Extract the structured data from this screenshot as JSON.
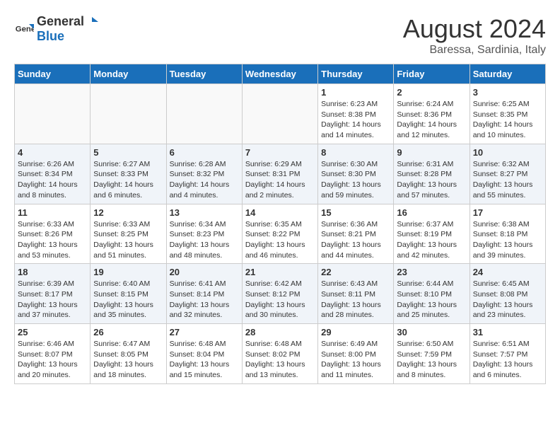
{
  "logo": {
    "text_general": "General",
    "text_blue": "Blue"
  },
  "title": "August 2024",
  "location": "Baressa, Sardinia, Italy",
  "days_header": [
    "Sunday",
    "Monday",
    "Tuesday",
    "Wednesday",
    "Thursday",
    "Friday",
    "Saturday"
  ],
  "weeks": [
    [
      {
        "day": "",
        "info": ""
      },
      {
        "day": "",
        "info": ""
      },
      {
        "day": "",
        "info": ""
      },
      {
        "day": "",
        "info": ""
      },
      {
        "day": "1",
        "info": "Sunrise: 6:23 AM\nSunset: 8:38 PM\nDaylight: 14 hours and 14 minutes."
      },
      {
        "day": "2",
        "info": "Sunrise: 6:24 AM\nSunset: 8:36 PM\nDaylight: 14 hours and 12 minutes."
      },
      {
        "day": "3",
        "info": "Sunrise: 6:25 AM\nSunset: 8:35 PM\nDaylight: 14 hours and 10 minutes."
      }
    ],
    [
      {
        "day": "4",
        "info": "Sunrise: 6:26 AM\nSunset: 8:34 PM\nDaylight: 14 hours and 8 minutes."
      },
      {
        "day": "5",
        "info": "Sunrise: 6:27 AM\nSunset: 8:33 PM\nDaylight: 14 hours and 6 minutes."
      },
      {
        "day": "6",
        "info": "Sunrise: 6:28 AM\nSunset: 8:32 PM\nDaylight: 14 hours and 4 minutes."
      },
      {
        "day": "7",
        "info": "Sunrise: 6:29 AM\nSunset: 8:31 PM\nDaylight: 14 hours and 2 minutes."
      },
      {
        "day": "8",
        "info": "Sunrise: 6:30 AM\nSunset: 8:30 PM\nDaylight: 13 hours and 59 minutes."
      },
      {
        "day": "9",
        "info": "Sunrise: 6:31 AM\nSunset: 8:28 PM\nDaylight: 13 hours and 57 minutes."
      },
      {
        "day": "10",
        "info": "Sunrise: 6:32 AM\nSunset: 8:27 PM\nDaylight: 13 hours and 55 minutes."
      }
    ],
    [
      {
        "day": "11",
        "info": "Sunrise: 6:33 AM\nSunset: 8:26 PM\nDaylight: 13 hours and 53 minutes."
      },
      {
        "day": "12",
        "info": "Sunrise: 6:33 AM\nSunset: 8:25 PM\nDaylight: 13 hours and 51 minutes."
      },
      {
        "day": "13",
        "info": "Sunrise: 6:34 AM\nSunset: 8:23 PM\nDaylight: 13 hours and 48 minutes."
      },
      {
        "day": "14",
        "info": "Sunrise: 6:35 AM\nSunset: 8:22 PM\nDaylight: 13 hours and 46 minutes."
      },
      {
        "day": "15",
        "info": "Sunrise: 6:36 AM\nSunset: 8:21 PM\nDaylight: 13 hours and 44 minutes."
      },
      {
        "day": "16",
        "info": "Sunrise: 6:37 AM\nSunset: 8:19 PM\nDaylight: 13 hours and 42 minutes."
      },
      {
        "day": "17",
        "info": "Sunrise: 6:38 AM\nSunset: 8:18 PM\nDaylight: 13 hours and 39 minutes."
      }
    ],
    [
      {
        "day": "18",
        "info": "Sunrise: 6:39 AM\nSunset: 8:17 PM\nDaylight: 13 hours and 37 minutes."
      },
      {
        "day": "19",
        "info": "Sunrise: 6:40 AM\nSunset: 8:15 PM\nDaylight: 13 hours and 35 minutes."
      },
      {
        "day": "20",
        "info": "Sunrise: 6:41 AM\nSunset: 8:14 PM\nDaylight: 13 hours and 32 minutes."
      },
      {
        "day": "21",
        "info": "Sunrise: 6:42 AM\nSunset: 8:12 PM\nDaylight: 13 hours and 30 minutes."
      },
      {
        "day": "22",
        "info": "Sunrise: 6:43 AM\nSunset: 8:11 PM\nDaylight: 13 hours and 28 minutes."
      },
      {
        "day": "23",
        "info": "Sunrise: 6:44 AM\nSunset: 8:10 PM\nDaylight: 13 hours and 25 minutes."
      },
      {
        "day": "24",
        "info": "Sunrise: 6:45 AM\nSunset: 8:08 PM\nDaylight: 13 hours and 23 minutes."
      }
    ],
    [
      {
        "day": "25",
        "info": "Sunrise: 6:46 AM\nSunset: 8:07 PM\nDaylight: 13 hours and 20 minutes."
      },
      {
        "day": "26",
        "info": "Sunrise: 6:47 AM\nSunset: 8:05 PM\nDaylight: 13 hours and 18 minutes."
      },
      {
        "day": "27",
        "info": "Sunrise: 6:48 AM\nSunset: 8:04 PM\nDaylight: 13 hours and 15 minutes."
      },
      {
        "day": "28",
        "info": "Sunrise: 6:48 AM\nSunset: 8:02 PM\nDaylight: 13 hours and 13 minutes."
      },
      {
        "day": "29",
        "info": "Sunrise: 6:49 AM\nSunset: 8:00 PM\nDaylight: 13 hours and 11 minutes."
      },
      {
        "day": "30",
        "info": "Sunrise: 6:50 AM\nSunset: 7:59 PM\nDaylight: 13 hours and 8 minutes."
      },
      {
        "day": "31",
        "info": "Sunrise: 6:51 AM\nSunset: 7:57 PM\nDaylight: 13 hours and 6 minutes."
      }
    ]
  ]
}
